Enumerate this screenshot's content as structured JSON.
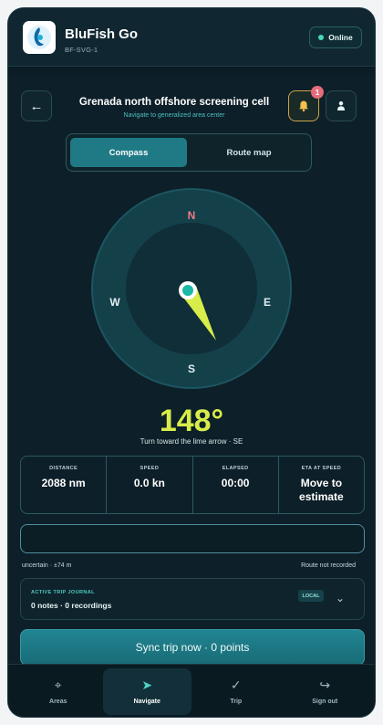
{
  "app": {
    "name": "BluFish Go",
    "device_id": "BF-SVG-1",
    "status": "Online"
  },
  "page": {
    "title": "Grenada north offshore screening cell",
    "subtitle": "Navigate to generalized area center",
    "notification_count": "1"
  },
  "tabs_view": [
    {
      "label": "Compass",
      "active": true
    },
    {
      "label": "Route map",
      "active": false
    }
  ],
  "compass": {
    "n": "N",
    "e": "E",
    "s": "S",
    "w": "W",
    "heading_deg": 148,
    "heading_label": "148°",
    "hint": "Turn toward the lime arrow · SE"
  },
  "stats": [
    {
      "label": "DISTANCE",
      "value": "2088 nm"
    },
    {
      "label": "SPEED",
      "value": "0.0 kn"
    },
    {
      "label": "ELAPSED",
      "value": "00:00"
    },
    {
      "label": "ETA AT SPEED",
      "value": "Move to estimate"
    }
  ],
  "gps": {
    "accuracy": "uncertain · ±74 m",
    "route_status": "Route not recorded"
  },
  "journal": {
    "label": "ACTIVE TRIP JOURNAL",
    "summary": "0 notes · 0 recordings",
    "tag": "LOCAL"
  },
  "sync_button": "Sync trip now · 0 points",
  "nav": [
    {
      "label": "Areas",
      "icon": "crosshair-icon"
    },
    {
      "label": "Navigate",
      "icon": "navigate-arrow-icon",
      "active": true
    },
    {
      "label": "Trip",
      "icon": "check-icon"
    },
    {
      "label": "Sign out",
      "icon": "sign-out-icon"
    }
  ],
  "colors": {
    "accent": "#1f7a86",
    "lime": "#d8ec4a",
    "north": "#f07b88",
    "bg": "#0d1f28"
  }
}
